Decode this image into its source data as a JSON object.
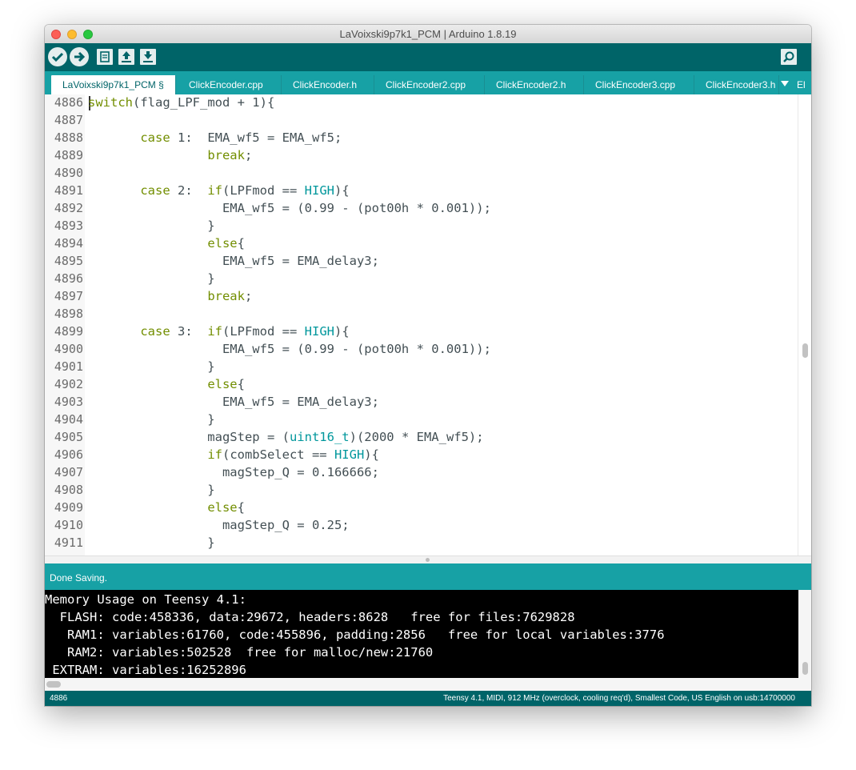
{
  "window": {
    "title": "LaVoixski9p7k1_PCM | Arduino 1.8.19"
  },
  "toolbar": {
    "verify_icon": "check-icon",
    "upload_icon": "arrow-right-icon",
    "new_icon": "new-file-icon",
    "open_icon": "open-up-icon",
    "save_icon": "save-down-icon",
    "serial_icon": "magnifier-icon"
  },
  "tabs": [
    {
      "label": "LaVoixski9p7k1_PCM §",
      "active": true
    },
    {
      "label": "ClickEncoder.cpp"
    },
    {
      "label": "ClickEncoder.h"
    },
    {
      "label": "ClickEncoder2.cpp"
    },
    {
      "label": "ClickEncoder2.h"
    },
    {
      "label": "ClickEncoder3.cpp"
    },
    {
      "label": "ClickEncoder3.h"
    },
    {
      "label": "El"
    }
  ],
  "editor": {
    "lines": [
      {
        "n": "4886",
        "code": [
          {
            "t": "switch",
            "c": "kw"
          },
          {
            "t": "(flag_LPF_mod + 1){",
            "c": "p"
          }
        ]
      },
      {
        "n": "4887",
        "code": []
      },
      {
        "n": "4888",
        "code": [
          {
            "t": "       ",
            "c": "p"
          },
          {
            "t": "case",
            "c": "kw"
          },
          {
            "t": " 1:  EMA_wf5 = EMA_wf5;",
            "c": "p"
          }
        ]
      },
      {
        "n": "4889",
        "code": [
          {
            "t": "                ",
            "c": "p"
          },
          {
            "t": "break",
            "c": "kw"
          },
          {
            "t": ";",
            "c": "p"
          }
        ]
      },
      {
        "n": "4890",
        "code": []
      },
      {
        "n": "4891",
        "code": [
          {
            "t": "       ",
            "c": "p"
          },
          {
            "t": "case",
            "c": "kw"
          },
          {
            "t": " 2:  ",
            "c": "p"
          },
          {
            "t": "if",
            "c": "kw"
          },
          {
            "t": "(LPFmod == ",
            "c": "p"
          },
          {
            "t": "HIGH",
            "c": "ty"
          },
          {
            "t": "){",
            "c": "p"
          }
        ]
      },
      {
        "n": "4892",
        "code": [
          {
            "t": "                  EMA_wf5 = (0.99 - (pot00h * 0.001));",
            "c": "p"
          }
        ]
      },
      {
        "n": "4893",
        "code": [
          {
            "t": "                }",
            "c": "p"
          }
        ]
      },
      {
        "n": "4894",
        "code": [
          {
            "t": "                ",
            "c": "p"
          },
          {
            "t": "else",
            "c": "kw"
          },
          {
            "t": "{",
            "c": "p"
          }
        ]
      },
      {
        "n": "4895",
        "code": [
          {
            "t": "                  EMA_wf5 = EMA_delay3;",
            "c": "p"
          }
        ]
      },
      {
        "n": "4896",
        "code": [
          {
            "t": "                }",
            "c": "p"
          }
        ]
      },
      {
        "n": "4897",
        "code": [
          {
            "t": "                ",
            "c": "p"
          },
          {
            "t": "break",
            "c": "kw"
          },
          {
            "t": ";",
            "c": "p"
          }
        ]
      },
      {
        "n": "4898",
        "code": []
      },
      {
        "n": "4899",
        "code": [
          {
            "t": "       ",
            "c": "p"
          },
          {
            "t": "case",
            "c": "kw"
          },
          {
            "t": " 3:  ",
            "c": "p"
          },
          {
            "t": "if",
            "c": "kw"
          },
          {
            "t": "(LPFmod == ",
            "c": "p"
          },
          {
            "t": "HIGH",
            "c": "ty"
          },
          {
            "t": "){",
            "c": "p"
          }
        ]
      },
      {
        "n": "4900",
        "code": [
          {
            "t": "                  EMA_wf5 = (0.99 - (pot00h * 0.001));",
            "c": "p"
          }
        ]
      },
      {
        "n": "4901",
        "code": [
          {
            "t": "                }",
            "c": "p"
          }
        ]
      },
      {
        "n": "4902",
        "code": [
          {
            "t": "                ",
            "c": "p"
          },
          {
            "t": "else",
            "c": "kw"
          },
          {
            "t": "{",
            "c": "p"
          }
        ]
      },
      {
        "n": "4903",
        "code": [
          {
            "t": "                  EMA_wf5 = EMA_delay3;",
            "c": "p"
          }
        ]
      },
      {
        "n": "4904",
        "code": [
          {
            "t": "                }",
            "c": "p"
          }
        ]
      },
      {
        "n": "4905",
        "code": [
          {
            "t": "                magStep = (",
            "c": "p"
          },
          {
            "t": "uint16_t",
            "c": "ty"
          },
          {
            "t": ")(2000 * EMA_wf5);",
            "c": "p"
          }
        ]
      },
      {
        "n": "4906",
        "code": [
          {
            "t": "                ",
            "c": "p"
          },
          {
            "t": "if",
            "c": "kw"
          },
          {
            "t": "(combSelect == ",
            "c": "p"
          },
          {
            "t": "HIGH",
            "c": "ty"
          },
          {
            "t": "){",
            "c": "p"
          }
        ]
      },
      {
        "n": "4907",
        "code": [
          {
            "t": "                  magStep_Q = 0.166666;",
            "c": "p"
          }
        ]
      },
      {
        "n": "4908",
        "code": [
          {
            "t": "                }",
            "c": "p"
          }
        ]
      },
      {
        "n": "4909",
        "code": [
          {
            "t": "                ",
            "c": "p"
          },
          {
            "t": "else",
            "c": "kw"
          },
          {
            "t": "{",
            "c": "p"
          }
        ]
      },
      {
        "n": "4910",
        "code": [
          {
            "t": "                  magStep_Q = 0.25;",
            "c": "p"
          }
        ]
      },
      {
        "n": "4911",
        "code": [
          {
            "t": "                }",
            "c": "p"
          }
        ]
      }
    ],
    "colors": {
      "kw": "#728e00",
      "ty": "#00979c",
      "p": "#434f54"
    }
  },
  "status": {
    "message": "Done Saving."
  },
  "console": {
    "lines": [
      "Memory Usage on Teensy 4.1:",
      "  FLASH: code:458336, data:29672, headers:8628   free for files:7629828",
      "   RAM1: variables:61760, code:455896, padding:2856   free for local variables:3776",
      "   RAM2: variables:502528  free for malloc/new:21760",
      " EXTRAM: variables:16252896"
    ]
  },
  "footer": {
    "line_number": "4886",
    "board_info": "Teensy 4.1, MIDI, 912 MHz (overclock, cooling req'd), Smallest Code, US English on usb:14700000"
  }
}
